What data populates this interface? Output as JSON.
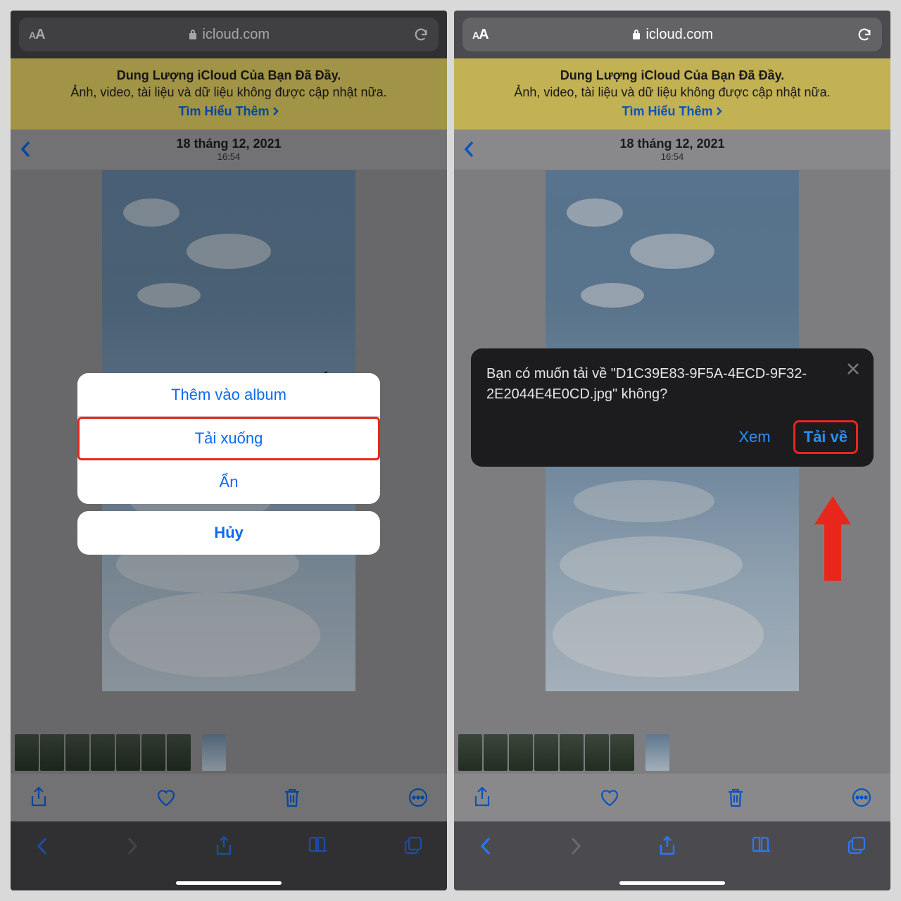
{
  "address_bar": {
    "domain": "icloud.com",
    "text_size_label": "AA"
  },
  "banner": {
    "title": "Dung Lượng iCloud Của Bạn Đã Đầy.",
    "subtitle": "Ảnh, video, tài liệu và dữ liệu không được cập nhật nữa.",
    "link": "Tìm Hiểu Thêm"
  },
  "photo_header": {
    "date": "18 tháng 12, 2021",
    "time": "16:54"
  },
  "action_sheet": {
    "add_to_album": "Thêm vào album",
    "download": "Tải xuống",
    "hide": "Ẩn",
    "cancel": "Hủy"
  },
  "download_prompt": {
    "message": "Bạn có muốn tải về \"D1C39E83-9F5A-4ECD-9F32-2E2044E4E0CD.jpg\" không?",
    "view": "Xem",
    "download": "Tải về"
  }
}
